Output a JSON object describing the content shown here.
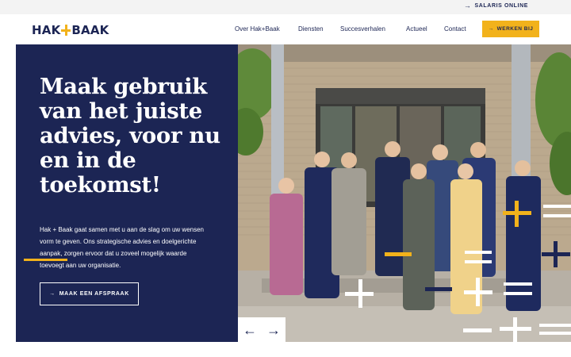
{
  "topbar": {
    "salaris_label": "SALARIS ONLINE"
  },
  "brand": {
    "logo_left": "HAK",
    "logo_right": "BAAK",
    "accent_color": "#f2b21b",
    "navy_color": "#1c2554"
  },
  "nav": {
    "items": [
      "Over Hak+Baak",
      "Diensten",
      "Succesverhalen",
      "Actueel",
      "Contact"
    ],
    "cta_label": "WERKEN BIJ"
  },
  "hero": {
    "headline": "Maak gebruik van het juiste advies, voor nu en in de toekomst!",
    "intro": "Hak + Baak gaat samen met u aan de slag om uw wensen vorm te geven. Ons strategische advies en doelgerichte aanpak, zorgen ervoor dat u zoveel mogelijk waarde toevoegt aan uw organisatie.",
    "cta_label": "MAAK EEN AFSPRAAK"
  },
  "photo": {
    "subject": "team-photo"
  },
  "slider": {
    "prev_icon": "arrow-left-icon",
    "next_icon": "arrow-right-icon"
  }
}
